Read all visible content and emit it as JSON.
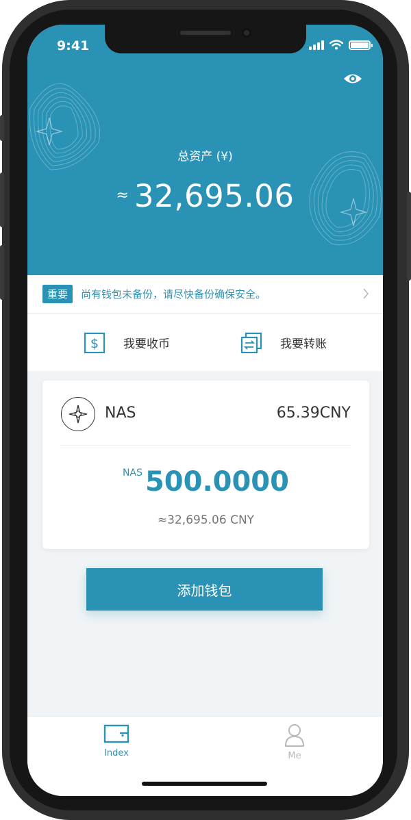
{
  "status_bar": {
    "time": "9:41"
  },
  "header": {
    "total_label": "总资产 (¥)",
    "approx_symbol": "≈",
    "total_value": "32,695.06"
  },
  "notice": {
    "badge": "重要",
    "text": "尚有钱包未备份，请尽快备份确保安全。"
  },
  "actions": {
    "receive_label": "我要收币",
    "transfer_label": "我要转账"
  },
  "wallet_card": {
    "token_name": "NAS",
    "token_price": "65.39CNY",
    "balance_unit": "NAS",
    "balance_value": "500.0000",
    "balance_cny": "≈32,695.06 CNY"
  },
  "add_wallet_label": "添加钱包",
  "tabs": [
    {
      "label": "Index"
    },
    {
      "label": "Me"
    }
  ],
  "colors": {
    "primary": "#2a92b5",
    "tab_inactive": "#b9b9b9"
  }
}
